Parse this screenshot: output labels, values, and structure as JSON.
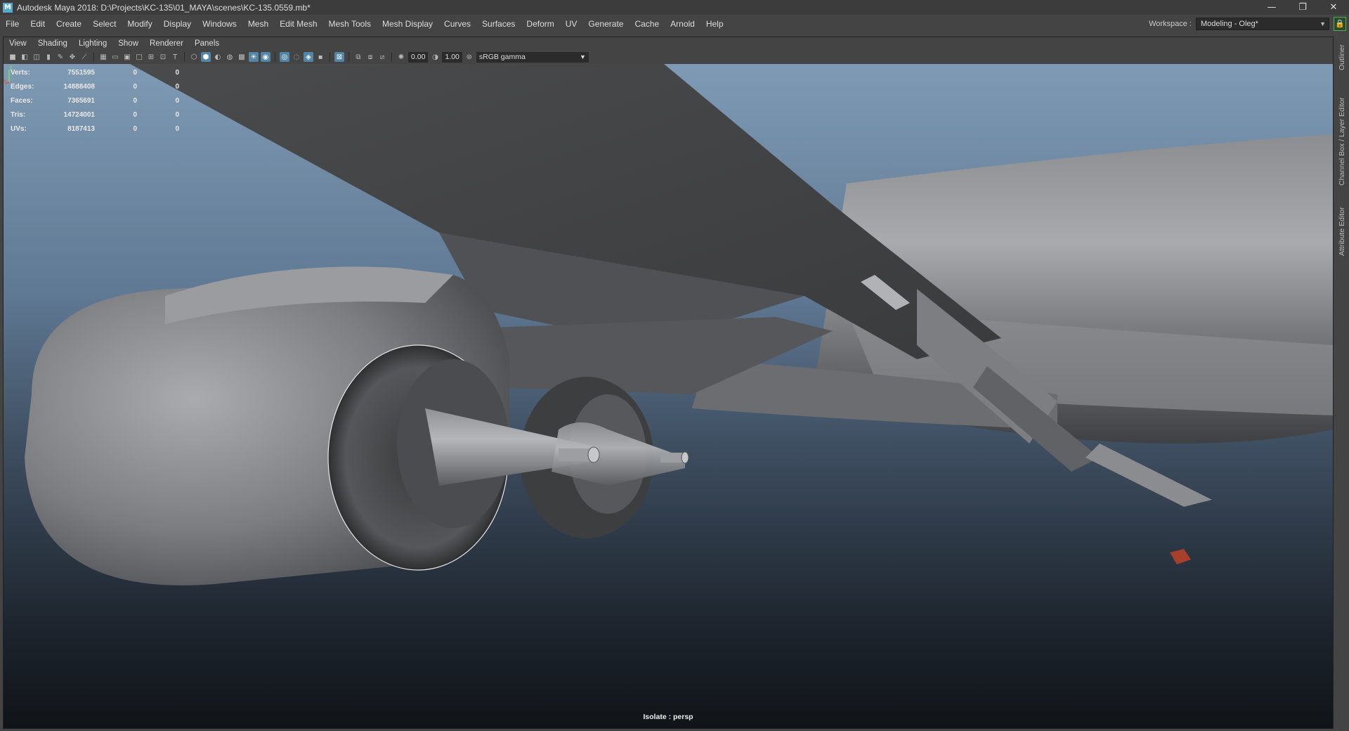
{
  "titlebar": {
    "title": "Autodesk Maya 2018: D:\\Projects\\KC-135\\01_MAYA\\scenes\\KC-135.0559.mb*",
    "logo_letter": "M",
    "minimize": "—",
    "restore": "❐",
    "close": "✕"
  },
  "menubar": {
    "items": [
      "File",
      "Edit",
      "Create",
      "Select",
      "Modify",
      "Display",
      "Windows",
      "Mesh",
      "Edit Mesh",
      "Mesh Tools",
      "Mesh Display",
      "Curves",
      "Surfaces",
      "Deform",
      "UV",
      "Generate",
      "Cache",
      "Arnold",
      "Help"
    ],
    "workspace_label": "Workspace :",
    "workspace_value": "Modeling - Oleg*"
  },
  "panel_menu": {
    "items": [
      "View",
      "Shading",
      "Lighting",
      "Show",
      "Renderer",
      "Panels"
    ]
  },
  "panel_toolbar": {
    "exposure": "0.00",
    "gamma": "1.00",
    "color_space": "sRGB gamma"
  },
  "hud": {
    "rows": [
      {
        "label": "Verts:",
        "value": "7551595",
        "a": "0",
        "b": "0"
      },
      {
        "label": "Edges:",
        "value": "14888408",
        "a": "0",
        "b": "0"
      },
      {
        "label": "Faces:",
        "value": "7365691",
        "a": "0",
        "b": "0"
      },
      {
        "label": "Tris:",
        "value": "14724001",
        "a": "0",
        "b": "0"
      },
      {
        "label": "UVs:",
        "value": "8187413",
        "a": "0",
        "b": "0"
      }
    ]
  },
  "viewport": {
    "isolate_label": "Isolate : persp",
    "axis_y": "y",
    "axis_x": "x"
  },
  "side_tabs": {
    "outliner": "Outliner",
    "channel_box": "Channel Box / Layer Editor",
    "attribute_editor": "Attribute Editor"
  },
  "colors": {
    "accent": "#5285a6",
    "sky_top": "#7f9ab4",
    "ground_bottom": "#101418"
  }
}
